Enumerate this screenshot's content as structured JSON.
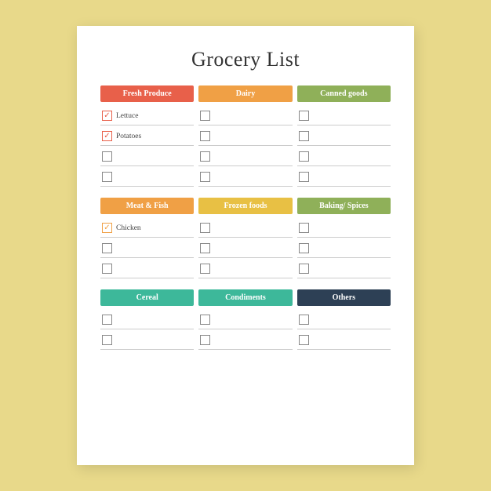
{
  "title": "Grocery List",
  "sections": [
    {
      "id": "section1",
      "headers": [
        {
          "label": "Fresh Produce",
          "color": "col-red"
        },
        {
          "label": "Dairy",
          "color": "col-orange"
        },
        {
          "label": "Canned goods",
          "color": "col-olive"
        }
      ],
      "rows": [
        [
          {
            "checked": true,
            "label": "Lettuce",
            "checkStyle": "checked"
          },
          {
            "checked": false,
            "label": ""
          },
          {
            "checked": false,
            "label": ""
          }
        ],
        [
          {
            "checked": true,
            "label": "Potatoes",
            "checkStyle": "checked"
          },
          {
            "checked": false,
            "label": ""
          },
          {
            "checked": false,
            "label": ""
          }
        ],
        [
          {
            "checked": false,
            "label": ""
          },
          {
            "checked": false,
            "label": ""
          },
          {
            "checked": false,
            "label": ""
          }
        ],
        [
          {
            "checked": false,
            "label": ""
          },
          {
            "checked": false,
            "label": ""
          },
          {
            "checked": false,
            "label": ""
          }
        ]
      ]
    },
    {
      "id": "section2",
      "headers": [
        {
          "label": "Meat & Fish",
          "color": "col-orange"
        },
        {
          "label": "Frozen foods",
          "color": "col-yellow"
        },
        {
          "label": "Baking/ Spices",
          "color": "col-olive"
        }
      ],
      "rows": [
        [
          {
            "checked": true,
            "label": "Chicken",
            "checkStyle": "checked-orange"
          },
          {
            "checked": false,
            "label": ""
          },
          {
            "checked": false,
            "label": ""
          }
        ],
        [
          {
            "checked": false,
            "label": ""
          },
          {
            "checked": false,
            "label": ""
          },
          {
            "checked": false,
            "label": ""
          }
        ],
        [
          {
            "checked": false,
            "label": ""
          },
          {
            "checked": false,
            "label": ""
          },
          {
            "checked": false,
            "label": ""
          }
        ]
      ]
    },
    {
      "id": "section3",
      "headers": [
        {
          "label": "Cereal",
          "color": "col-green"
        },
        {
          "label": "Condiments",
          "color": "col-green"
        },
        {
          "label": "Others",
          "color": "col-dark"
        }
      ],
      "rows": [
        [
          {
            "checked": false,
            "label": ""
          },
          {
            "checked": false,
            "label": ""
          },
          {
            "checked": false,
            "label": ""
          }
        ],
        [
          {
            "checked": false,
            "label": ""
          },
          {
            "checked": false,
            "label": ""
          },
          {
            "checked": false,
            "label": ""
          }
        ]
      ]
    }
  ]
}
